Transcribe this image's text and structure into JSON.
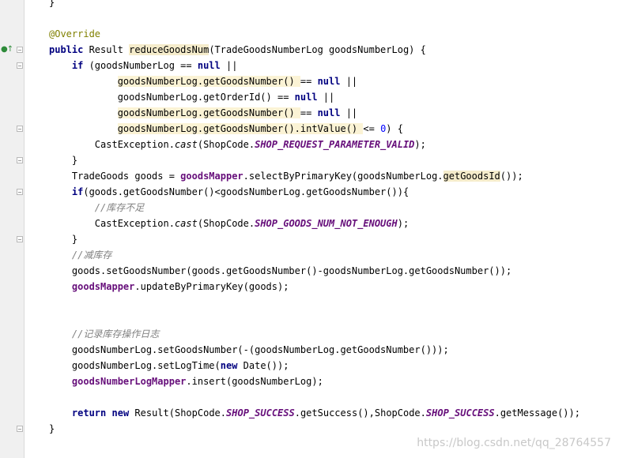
{
  "editor": {
    "lines": [
      "}",
      "",
      "@Override",
      "public Result reduceGoodsNum(TradeGoodsNumberLog goodsNumberLog) {",
      "    if (goodsNumberLog == null ||",
      "            goodsNumberLog.getGoodsNumber() == null ||",
      "            goodsNumberLog.getOrderId() == null ||",
      "            goodsNumberLog.getGoodsNumber() == null ||",
      "            goodsNumberLog.getGoodsNumber().intValue() <= 0) {",
      "        CastException.cast(ShopCode.SHOP_REQUEST_PARAMETER_VALID);",
      "    }",
      "    TradeGoods goods = goodsMapper.selectByPrimaryKey(goodsNumberLog.getGoodsId());",
      "    if(goods.getGoodsNumber()<goodsNumberLog.getGoodsNumber()){",
      "        //库存不足",
      "        CastException.cast(ShopCode.SHOP_GOODS_NUM_NOT_ENOUGH);",
      "    }",
      "    //减库存",
      "    goods.setGoodsNumber(goods.getGoodsNumber()-goodsNumberLog.getGoodsNumber());",
      "    goodsMapper.updateByPrimaryKey(goods);",
      "",
      "",
      "    //记录库存操作日志",
      "    goodsNumberLog.setGoodsNumber(-(goodsNumberLog.getGoodsNumber()));",
      "    goodsNumberLog.setLogTime(new Date());",
      "    goodsNumberLogMapper.insert(goodsNumberLog);",
      "",
      "    return new Result(ShopCode.SHOP_SUCCESS.getSuccess(),ShopCode.SHOP_SUCCESS.getMessage());",
      "}"
    ]
  },
  "gutter": {
    "override_marker": "●↑"
  },
  "watermark": "https://blog.csdn.net/qq_28764557",
  "colors": {
    "keyword": "#000080",
    "annotation": "#808000",
    "field": "#660e7a",
    "comment": "#808080",
    "number": "#0000ff",
    "highlight": "#fbf3d5",
    "gutter_bg": "#f0f0f0"
  }
}
